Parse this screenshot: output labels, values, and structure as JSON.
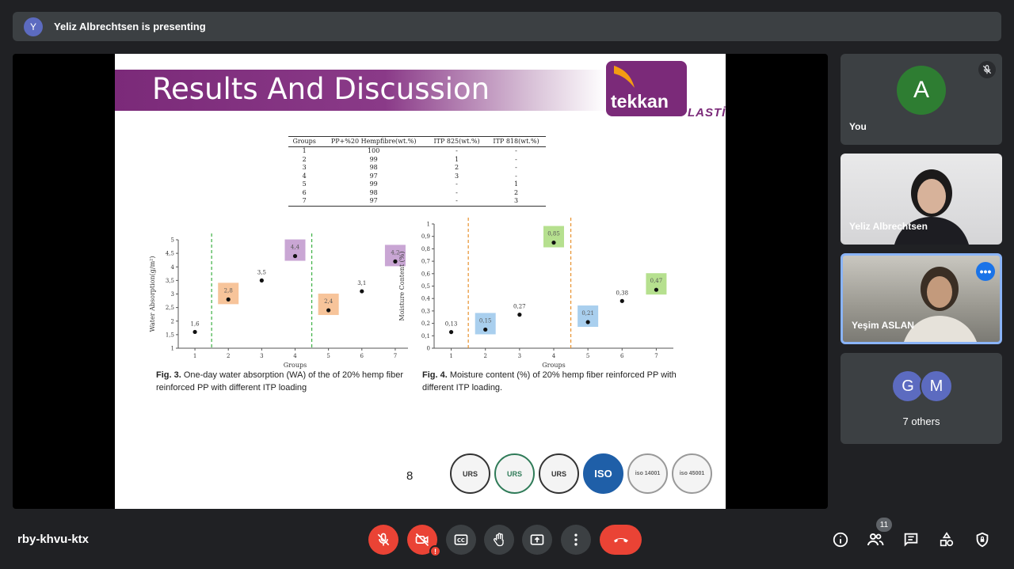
{
  "presenting": {
    "initial": "Y",
    "text": "Yeliz Albrechtsen is presenting"
  },
  "slide": {
    "title": "Results And Discussion",
    "logo_word": "tekkan",
    "logo_sub": "PLASTİK",
    "page_number": "8",
    "cert_labels": [
      "URS",
      "URS",
      "URS",
      "ISO",
      "iso 14001",
      "iso 45001"
    ],
    "table": {
      "headers": [
        "Groups",
        "PP+%20 Hempfibre(wt.%)",
        "ITP 825(wt.%)",
        "ITP 818(wt.%)"
      ],
      "rows": [
        [
          "1",
          "100",
          "-",
          "-"
        ],
        [
          "2",
          "99",
          "1",
          "-"
        ],
        [
          "3",
          "98",
          "2",
          "-"
        ],
        [
          "4",
          "97",
          "3",
          "-"
        ],
        [
          "5",
          "99",
          "-",
          "1"
        ],
        [
          "6",
          "98",
          "-",
          "2"
        ],
        [
          "7",
          "97",
          "-",
          "3"
        ]
      ]
    },
    "caption_fig3_label": "Fig. 3.",
    "caption_fig3_text": " One-day water absorption (WA) of the of 20% hemp fiber reinforced PP with different ITP loading",
    "caption_fig4_label": "Fig. 4.",
    "caption_fig4_text": " Moisture content (%) of 20% hemp fiber reinforced PP with different ITP loading."
  },
  "chart_data": [
    {
      "type": "scatter",
      "xlabel": "Groups",
      "ylabel": "Water Absorption(g/m²)",
      "ylim": [
        1,
        5
      ],
      "yticks": [
        "1",
        "1,5",
        "2",
        "2,5",
        "3",
        "3,5",
        "4",
        "4,5",
        "5"
      ],
      "x": [
        "1",
        "2",
        "3",
        "4",
        "5",
        "6",
        "7"
      ],
      "values": [
        1.6,
        2.8,
        3.5,
        4.4,
        2.4,
        3.1,
        4.2
      ],
      "labels": [
        "1,6",
        "2,8",
        "3,5",
        "4,4",
        "2,4",
        "3,1",
        "4,2"
      ],
      "highlight": [
        "",
        "#f7c49a",
        "",
        "#c9a6d4",
        "#f7c49a",
        "",
        "#c9a6d4"
      ],
      "divider_color": "#3cb043",
      "grid": false
    },
    {
      "type": "scatter",
      "xlabel": "Groups",
      "ylabel": "Moisture Content (%)",
      "ylim": [
        0,
        1
      ],
      "yticks": [
        "0",
        "0,1",
        "0,2",
        "0,3",
        "0,4",
        "0,5",
        "0,6",
        "0,7",
        "0,8",
        "0,9",
        "1"
      ],
      "x": [
        "1",
        "2",
        "3",
        "4",
        "5",
        "6",
        "7"
      ],
      "values": [
        0.13,
        0.15,
        0.27,
        0.85,
        0.21,
        0.38,
        0.47
      ],
      "labels": [
        "0,13",
        "0,15",
        "0,27",
        "0,85",
        "0,21",
        "0,38",
        "0,47"
      ],
      "highlight": [
        "",
        "#a9cfee",
        "",
        "#b6e08f",
        "#a9cfee",
        "",
        "#b6e08f"
      ],
      "divider_color": "#e8912d",
      "grid": false
    }
  ],
  "participants": {
    "you": {
      "initial": "A",
      "name": "You"
    },
    "p1": {
      "name": "Yeliz Albrechtsen"
    },
    "p2": {
      "name": "Yeşim ASLAN"
    },
    "others": {
      "initials": [
        "G",
        "M"
      ],
      "count_text": "7 others",
      "colors": [
        "#5c6bc0",
        "#5c6bc0"
      ]
    }
  },
  "bottom": {
    "meeting_code": "rby-khvu-ktx",
    "people_count": "11"
  }
}
